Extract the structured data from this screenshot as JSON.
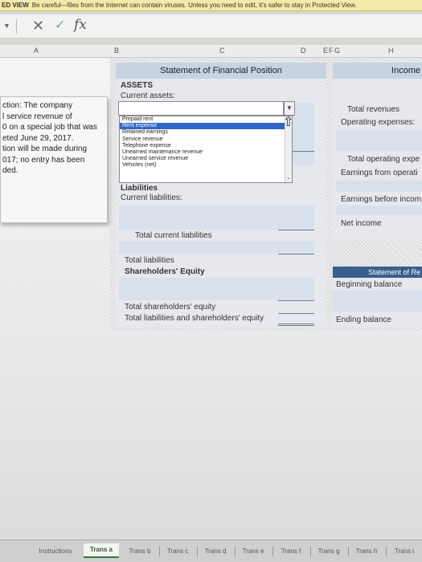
{
  "protected_view": {
    "title": "ED VIEW",
    "message": "Be careful—files from the Internet can contain viruses. Unless you need to edit, it's safer to stay in Protected View."
  },
  "formula_bar": {
    "fx_label": "fx",
    "cancel_glyph": "✕",
    "enter_glyph": "✓"
  },
  "columns": {
    "a": "A",
    "b": "B",
    "c": "C",
    "d": "D",
    "e": "E",
    "f": "F",
    "g": "G",
    "h": "H"
  },
  "comment_text": "ction: The company\nl service revenue of\n0 on a special job that was\neted June 29, 2017.\ntion will be made during\n017; no entry has been\nded.",
  "balance_sheet": {
    "header": "Statement of Financial Position",
    "assets": "ASSETS",
    "current_assets": "Current assets:",
    "liabilities": "Liabilities",
    "current_liabilities": "Current liabilities:",
    "total_current_liabilities": "Total current liabilities",
    "total_liabilities": "Total liabilities",
    "shareholders_equity": "Shareholders' Equity",
    "total_shareholders_equity": "Total shareholders' equity",
    "total_liabilities_and_equity": "Total liabilities and shareholders' equity"
  },
  "dropdown_options": [
    "Prepaid rent",
    "Rent expense",
    "Retained earnings",
    "Service revenue",
    "Telephone expense",
    "Unearned maintenance revenue",
    "Unearned service revenue",
    "Vehicles (net)"
  ],
  "dropdown_selected": "Rent expense",
  "income_statement": {
    "header": "Income",
    "total_revenues": "Total revenues",
    "operating_expenses": "Operating expenses:",
    "total_operating_expenses": "Total operating expe",
    "earnings_from_operations": "Earnings from operati",
    "earnings_before_income": "Earnings before incom",
    "net_income": "Net income"
  },
  "retained_earnings": {
    "header": "Statement of Re",
    "beginning_balance": "Beginning balance",
    "ending_balance": "Ending balance"
  },
  "sheet_tabs": [
    "Instructions",
    "Trans a",
    "Trans b",
    "Trans c",
    "Trans d",
    "Trans e",
    "Trans f",
    "Trans g",
    "Trans h",
    "Trans i"
  ],
  "active_tab": "Trans a"
}
